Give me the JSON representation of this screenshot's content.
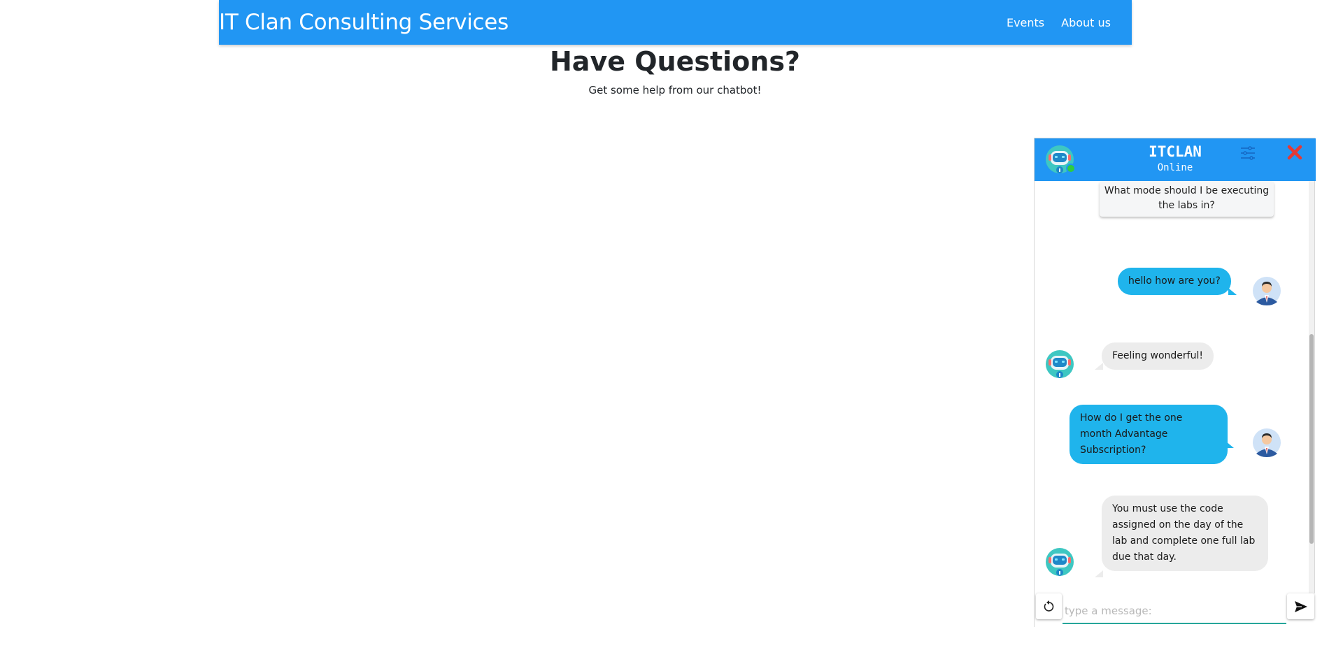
{
  "navbar": {
    "brand": "IT Clan Consulting Services",
    "links": [
      "Events",
      "About us"
    ]
  },
  "hero": {
    "title": "Have Questions?",
    "subtitle": "Get some help from our chatbot!"
  },
  "chat": {
    "title": "ITCLAN",
    "status": "Online",
    "quick_reply": "What mode should I be executing the labs in?",
    "messages": [
      {
        "from": "user",
        "text": "hello how are you?"
      },
      {
        "from": "bot",
        "text": "Feeling wonderful!"
      },
      {
        "from": "user",
        "text": "How do I get the one month Advantage Subscription?"
      },
      {
        "from": "bot",
        "text": "You must use the code assigned on the day of the lab and complete one full lab due that day."
      }
    ],
    "input_placeholder": "type a message:",
    "colors": {
      "header": "#2196f3",
      "user_bubble": "#1fb4ec",
      "bot_bubble": "#ececec",
      "online": "#2ecc40",
      "close": "#e53935",
      "input_underline": "#26a69a"
    },
    "icons": [
      "bot-avatar-icon",
      "settings-sliders-icon",
      "close-x-icon",
      "user-avatar-icon",
      "reset-icon",
      "send-icon"
    ]
  }
}
